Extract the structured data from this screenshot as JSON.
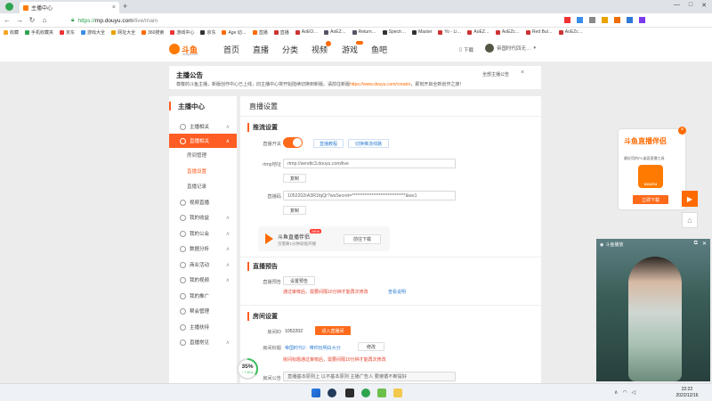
{
  "browser": {
    "tab_title": "主播中心",
    "url_prefix": "https://",
    "url_host": "mp.douyu.com",
    "url_path": "/live/main",
    "bookmarks": [
      "收藏",
      "手机收藏夹",
      "京东",
      "游戏大全",
      "网址大全",
      "360搜索",
      "游戏中心",
      "京东",
      "Age 动…",
      "直播",
      "直播",
      "AoEO…",
      "AoEZ…",
      "Return…",
      "Spectr…",
      "Master",
      "Yo - Li…",
      "AoEZ…",
      "AoEZc…",
      "Red Bul…",
      "AoEZc…"
    ]
  },
  "site": {
    "logo_text": "斗鱼",
    "logo_sub": "douyu.com",
    "nav": [
      "首页",
      "直播",
      "分类",
      "视频",
      "游戏",
      "鱼吧"
    ],
    "download": "下载",
    "user": "帝国时代四无…"
  },
  "notice": {
    "title": "主播公告",
    "text": "尊敬的斗鱼主播，新版创作中心已上线，旧主播中心将开始陆续切换到新版。请前往新版",
    "link": "https://www.douyu.com/creator",
    "text_after": "，即刻开启全新创作之旅！",
    "action": "全部主播公告"
  },
  "sidebar": {
    "title": "主播中心",
    "items": [
      {
        "label": "主播相关",
        "chev": "∧"
      },
      {
        "label": "直播相关",
        "chev": "∧"
      },
      {
        "label": "视频直播",
        "chev": ""
      },
      {
        "label": "我的收益",
        "chev": "∧"
      },
      {
        "label": "我的公会",
        "chev": "∧"
      },
      {
        "label": "数据分析",
        "chev": "∧"
      },
      {
        "label": "商业活动",
        "chev": "∧"
      },
      {
        "label": "我的视频",
        "chev": "∧"
      },
      {
        "label": "我的推广",
        "chev": ""
      },
      {
        "label": "帮会管理",
        "chev": ""
      },
      {
        "label": "主播扶持",
        "chev": ""
      },
      {
        "label": "直播常见",
        "chev": "∧"
      }
    ],
    "subitems": [
      "房间管理",
      "直播设置",
      "直播记录"
    ]
  },
  "main": {
    "title": "直播设置",
    "stream": {
      "heading": "推流设置",
      "switch_label": "直播开关",
      "btn_tutorial": "直播教程",
      "btn_line": "切换推流线路",
      "rtmp_label": "rtmp地址",
      "rtmp_value": "rtmp://sendtc3.douyu.com/live",
      "copy": "复制",
      "code_label": "直播码",
      "code_value": "1052202rA3R1fqQr?wsSecret=******************************&ws1",
      "assistant_name": "斗鱼直播伴侣",
      "assistant_desc": "仅需要1分钟就能开播",
      "assistant_tag": "NEW",
      "assistant_btn": "前往下载"
    },
    "preview": {
      "heading": "直播预告",
      "label": "直播预告",
      "btn": "设置预告",
      "warn": "通过审核后，需要间隔10分钟才能再次修改",
      "link": "查看说明"
    },
    "room": {
      "heading": "房间设置",
      "id_label": "房间ID",
      "id_value": "1052202",
      "enter_btn": "进入直播间",
      "title_label": "房间标题",
      "title_value": "帝国时代2：带你玩明白大分",
      "modify": "修改",
      "warn": "房间标题通过审核后，需要间隔10分钟才能再次修改",
      "announce_label": "房间公告",
      "announce_value": "直播基本原则上 以不基本原则 主播广告人 要遵循不断提好"
    }
  },
  "progress": {
    "percent": 35,
    "label": "35%",
    "sub": "↑ 7.4K/s"
  },
  "promo": {
    "title": "斗鱼直播伴侣",
    "sub": "最好用的PC桌面直播工具",
    "brand": "DOUYU",
    "btn": "立即下载"
  },
  "video": {
    "label": "斗鱼播放"
  },
  "taskbar": {
    "time": "22:22",
    "date": "2022/12/16"
  },
  "colors": {
    "accent": "#ff5d23",
    "link": "#2f7fd5",
    "warn": "#e43f2a"
  }
}
